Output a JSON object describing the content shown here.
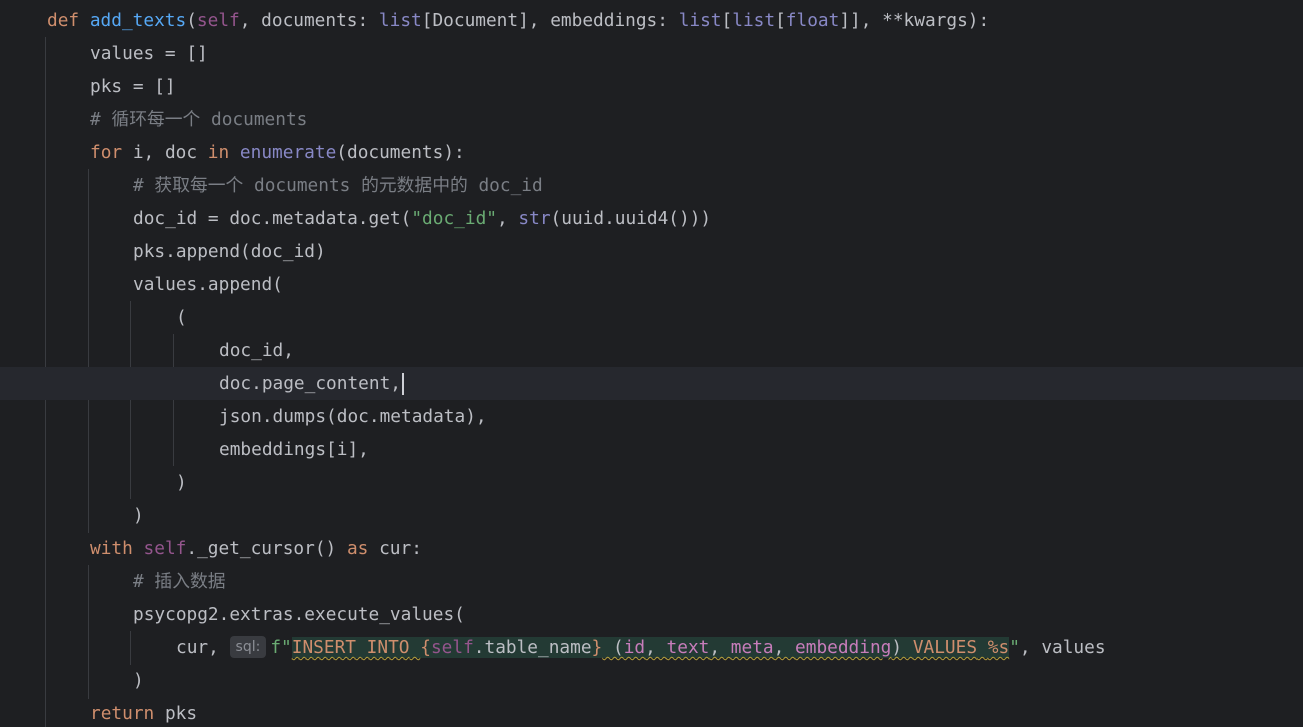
{
  "editor": {
    "hint_label": "sql:",
    "lines": {
      "l1": {
        "kw": "def",
        "fn": "add_texts",
        "p1": "(",
        "self": "self",
        "p2": ", documents: ",
        "t1": "list",
        "p3": "[Document], embeddings: ",
        "t2": "list",
        "p4": "[",
        "t3": "list",
        "p5": "[",
        "t4": "float",
        "p6": "]], **kwargs):"
      },
      "l2": {
        "text": "values = []"
      },
      "l3": {
        "text": "pks = []"
      },
      "l4": {
        "cmt": "# 循环每一个 documents"
      },
      "l5": {
        "kw1": "for",
        "t1": " i, doc ",
        "kw2": "in",
        "t2": " ",
        "builtin": "enumerate",
        "t3": "(documents):"
      },
      "l6": {
        "cmt": "# 获取每一个 documents 的元数据中的 doc_id"
      },
      "l7": {
        "t1": "doc_id = doc.metadata.get(",
        "str": "\"doc_id\"",
        "t2": ", ",
        "builtin": "str",
        "t3": "(uuid.uuid4()))"
      },
      "l8": {
        "text": "pks.append(doc_id)"
      },
      "l9": {
        "text": "values.append("
      },
      "l10": {
        "text": "("
      },
      "l11": {
        "text": "doc_id,"
      },
      "l12": {
        "text": "doc.page_content,"
      },
      "l13": {
        "text": "json.dumps(doc.metadata),"
      },
      "l14": {
        "text": "embeddings[i],"
      },
      "l15": {
        "text": ")"
      },
      "l16": {
        "text": ")"
      },
      "l17": {
        "kw1": "with",
        "t1": " ",
        "self": "self",
        "t2": "._get_cursor() ",
        "kw2": "as",
        "t3": " cur:"
      },
      "l18": {
        "cmt": "# 插入数据"
      },
      "l19": {
        "text": "psycopg2.extras.execute_values("
      },
      "l20": {
        "t1": "cur, ",
        "fpre": "f\"",
        "sql1": "INSERT INTO",
        "sp1": " ",
        "brace1": "{",
        "self": "self",
        "attr": ".table_name",
        "brace2": "}",
        "sp2": " (",
        "c1": "id",
        "cm1": ", ",
        "c2": "text",
        "cm2": ", ",
        "c3": "meta",
        "cm3": ", ",
        "c4": "embedding",
        "close": ") ",
        "sql2": "VALUES",
        "sp3": " ",
        "fmt": "%s",
        "fend": "\"",
        "t2": ", values"
      },
      "l21": {
        "text": ")"
      },
      "l22": {
        "kw": "return",
        "t1": " pks"
      }
    }
  }
}
